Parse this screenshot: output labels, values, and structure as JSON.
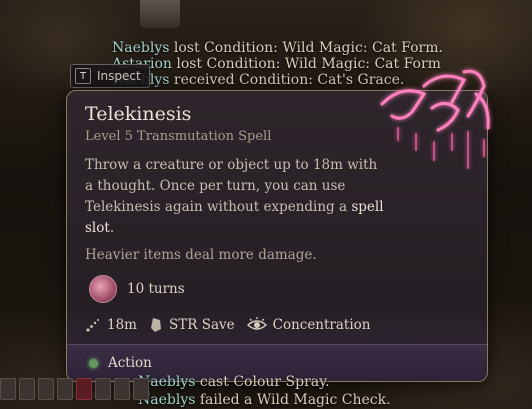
{
  "combat_log_top": [
    {
      "name": "Naeblys",
      "text": " lost Condition: Wild Magic: Cat Form."
    },
    {
      "name": "Astarion",
      "text": " lost Condition: Wild Magic: Cat Form"
    },
    {
      "name": "Naeblys",
      "text": " received Condition: Cat's Grace."
    }
  ],
  "combat_log_bottom": [
    {
      "name": "Naeblys",
      "text": " cast Colour Spray."
    },
    {
      "name": "Naeblys",
      "text": " failed a Wild Magic Check."
    }
  ],
  "inspect": {
    "key": "T",
    "label": "Inspect"
  },
  "spell": {
    "name": "Telekinesis",
    "subtitle": "Level 5 Transmutation Spell",
    "description_plain": "Throw a creature or object up to 18m with a thought. Once per turn, you can use Telekinesis again without expending a",
    "description_bold": "spell slot",
    "description_end": ".",
    "note": "Heavier items deal more damage.",
    "duration": "10 turns",
    "range": "18m",
    "save": "STR Save",
    "concentration": "Concentration",
    "cost": "Action"
  },
  "colors": {
    "accent_action": "#5f9a5c",
    "spell_art": "#ff6fb1",
    "border": "#8b7a62"
  },
  "icons": [
    "inspect-key-icon",
    "duration-icon",
    "range-icon",
    "save-icon",
    "concentration-icon",
    "action-dot-icon",
    "spell-art-icon"
  ]
}
